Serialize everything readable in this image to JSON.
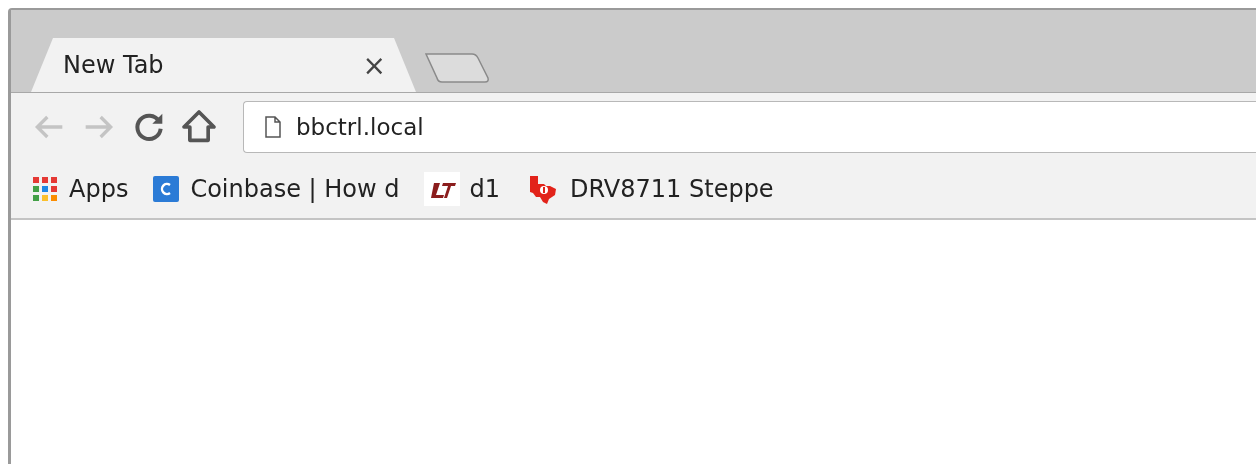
{
  "tabs": [
    {
      "label": "New Tab",
      "close": "×",
      "selected": true
    }
  ],
  "toolbar": {
    "back_disabled": true,
    "forward_disabled": true
  },
  "address_bar": {
    "value": "bbctrl.local"
  },
  "bookmarks": [
    {
      "kind": "apps",
      "label": "Apps"
    },
    {
      "kind": "coinbase",
      "label": "Coinbase | How d"
    },
    {
      "kind": "lt",
      "label": "d1"
    },
    {
      "kind": "ti",
      "label": "DRV8711 Steppe"
    }
  ]
}
